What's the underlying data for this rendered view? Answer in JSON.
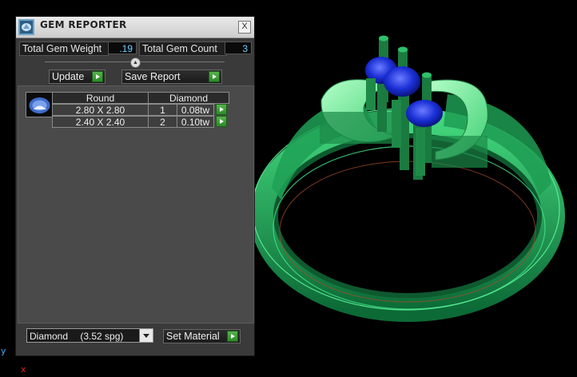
{
  "panel": {
    "title": "GEM REPORTER",
    "close_label": "X",
    "total_weight_label": "Total Gem Weight",
    "total_weight_value": ".19",
    "total_count_label": "Total Gem Count",
    "total_count_value": "3",
    "update_label": "Update",
    "save_report_label": "Save Report",
    "table": {
      "shape_header": "Round",
      "material_header": "Diamond",
      "rows": [
        {
          "size": "2.80 X 2.80",
          "count": "1",
          "weight": "0.08tw"
        },
        {
          "size": "2.40 X 2.40",
          "count": "2",
          "weight": "0.10tw"
        }
      ]
    },
    "material_select": {
      "name": "Diamond",
      "spg": "(3.52 spg)"
    },
    "set_material_label": "Set Material"
  },
  "viewport": {
    "axis_y": "y",
    "axis_x": "x"
  },
  "colors": {
    "ring_green": "#33d17a",
    "gem_blue": "#1a2fd6",
    "accent_value": "#6ed0ff",
    "go_button": "#3aa234"
  }
}
